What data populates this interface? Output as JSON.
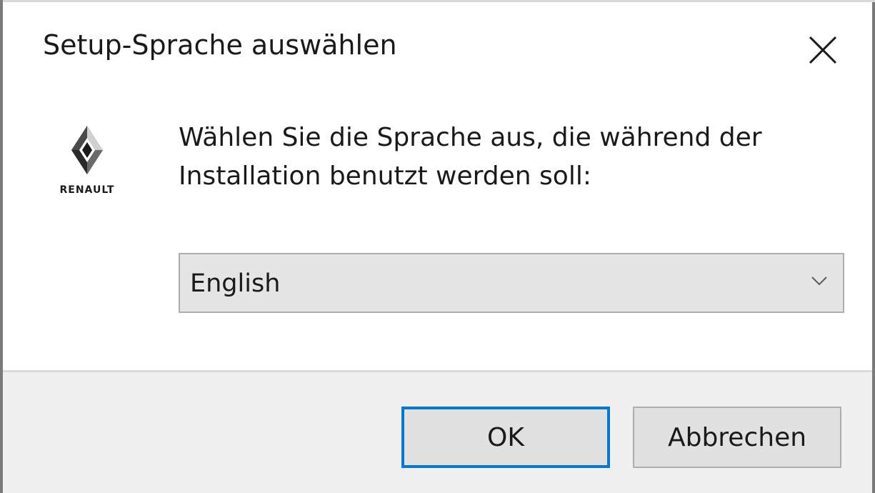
{
  "dialog": {
    "title": "Setup-Sprache auswählen",
    "message_line1": "Wählen Sie die Sprache aus, die während der",
    "message_line2": "Installation benutzt werden soll:",
    "logo_text": "RENAULT",
    "close_icon": "close-icon"
  },
  "language_select": {
    "value": "English",
    "chevron_icon": "chevron-down-icon"
  },
  "buttons": {
    "ok_label": "OK",
    "cancel_label": "Abbrechen"
  },
  "colors": {
    "focus_border": "#0078d7",
    "footer_bg": "#f0f0f0",
    "button_bg": "#e1e1e1",
    "select_bg": "#e5e5e5"
  }
}
